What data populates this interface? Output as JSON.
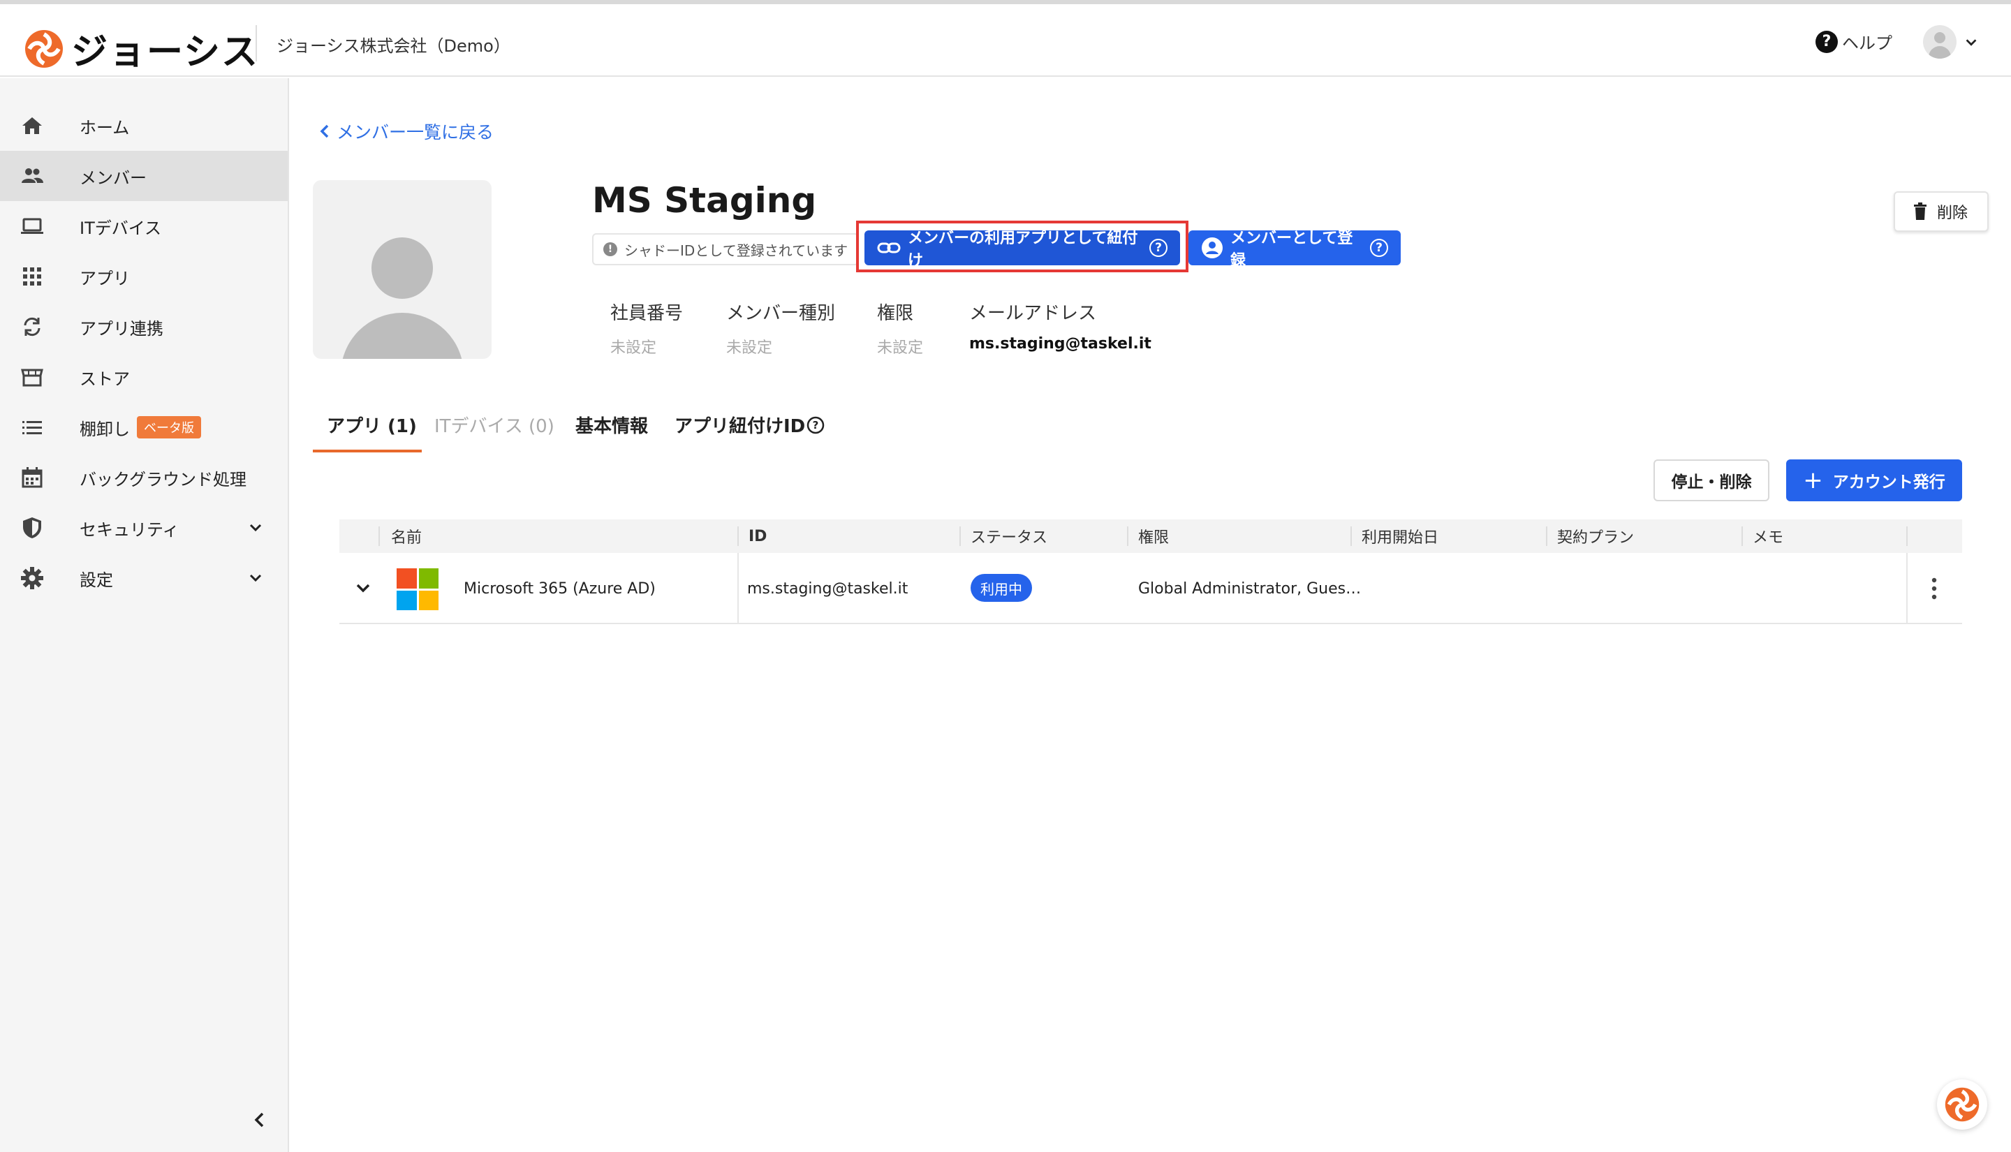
{
  "header": {
    "logo_text": "ジョーシス",
    "company": "ジョーシス株式会社（Demo）",
    "help_label": "ヘルプ",
    "help_icon": "help-circle-icon"
  },
  "sidebar": {
    "items": [
      {
        "label": "ホーム",
        "icon": "home-icon"
      },
      {
        "label": "メンバー",
        "icon": "people-icon",
        "active": true
      },
      {
        "label": "ITデバイス",
        "icon": "laptop-icon"
      },
      {
        "label": "アプリ",
        "icon": "grid-icon"
      },
      {
        "label": "アプリ連携",
        "icon": "sync-icon"
      },
      {
        "label": "ストア",
        "icon": "store-icon"
      },
      {
        "label": "棚卸し",
        "icon": "list-icon",
        "badge": "ベータ版"
      },
      {
        "label": "バックグラウンド処理",
        "icon": "calendar-icon"
      },
      {
        "label": "セキュリティ",
        "icon": "shield-icon",
        "expandable": true
      },
      {
        "label": "設定",
        "icon": "gear-icon",
        "expandable": true
      }
    ]
  },
  "main": {
    "back_link": "メンバー一覧に戻る",
    "member_name": "MS Staging",
    "shadow_id_note": "シャドーIDとして登録されています",
    "link_button": "メンバーの利用アプリとして紐付け",
    "register_button": "メンバーとして登録",
    "delete_button": "削除",
    "info": {
      "employee_no_label": "社員番号",
      "employee_no_value": "未設定",
      "member_type_label": "メンバー種別",
      "member_type_value": "未設定",
      "role_label": "権限",
      "role_value": "未設定",
      "email_label": "メールアドレス",
      "email_value": "ms.staging@taskel.it"
    },
    "tabs": [
      {
        "label": "アプリ (1)",
        "active": true
      },
      {
        "label": "ITデバイス (0)",
        "disabled": true
      },
      {
        "label": "基本情報"
      },
      {
        "label": "アプリ紐付けID"
      }
    ],
    "stop_delete_button": "停止・削除",
    "issue_account_button": "アカウント発行",
    "table": {
      "columns": [
        "名前",
        "ID",
        "ステータス",
        "権限",
        "利用開始日",
        "契約プラン",
        "メモ"
      ],
      "rows": [
        {
          "name": "Microsoft 365 (Azure AD)",
          "id": "ms.staging@taskel.it",
          "status": "利用中",
          "role": "Global Administrator, Gues…",
          "start_date": "",
          "plan": "",
          "memo": ""
        }
      ]
    }
  },
  "colors": {
    "primary": "#2563eb",
    "link": "#2f6fe4",
    "accent": "#e8692c",
    "highlight": "#e53935",
    "beta_badge": "#f07a3a"
  }
}
